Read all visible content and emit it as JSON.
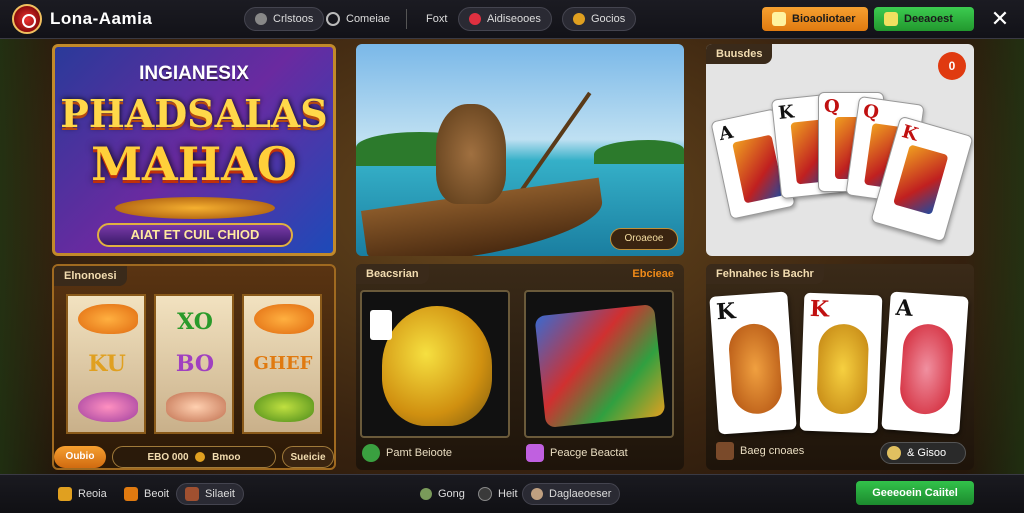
{
  "app": {
    "brand": "Lona-Aamia"
  },
  "topbar": {
    "nav": [
      {
        "label": "Crlstoos",
        "icon": "dice-icon"
      },
      {
        "label": "Comeiae",
        "icon": "clock-icon"
      },
      {
        "label": "Foxt",
        "icon": ""
      },
      {
        "label": "Aidiseooes",
        "icon": "chip-icon"
      },
      {
        "label": "Gocios",
        "icon": "coin-icon"
      }
    ],
    "btn_orange": "Bioaoliotaer",
    "btn_green": "Deeaoest",
    "close": "✕"
  },
  "panel1": {
    "line1": "INGIANESIX",
    "line2": "PHADSALAS",
    "line3": "MAHAO",
    "band": "AIAT ET CUIL CHIOD"
  },
  "panel2": {
    "button": "Oroaeoe"
  },
  "panel3": {
    "tag": "Buusdes",
    "badge": "0",
    "cards": [
      "A",
      "K",
      "Q",
      "Q",
      "K"
    ]
  },
  "panel4": {
    "tag": "Elnonoesi",
    "reels": [
      [
        "fish",
        "KU",
        "fish"
      ],
      [
        "XO",
        "BO",
        "chef"
      ],
      [
        "fish",
        "GHEF",
        "fish"
      ]
    ],
    "btn_left": "Oubio",
    "btn_mid": "EBO 000",
    "btn_mid_tail": "Bmoo",
    "btn_right": "Sueicie"
  },
  "panel5": {
    "tag": "Beacsrian",
    "tag_right": "Ebcieae",
    "tiles": [
      {
        "label": "Pamt Beioote"
      },
      {
        "label": "Peacge Beactat"
      }
    ]
  },
  "panel6": {
    "tag": "Fehnahec is Bachr",
    "cards": [
      "K",
      "K",
      "A"
    ],
    "label": "Baeg cnoaes",
    "pill": "& Gisoo"
  },
  "bottombar": {
    "left": [
      {
        "label": "Reoia"
      },
      {
        "label": "Beoit"
      },
      {
        "label": "Silaeit"
      }
    ],
    "center": [
      {
        "label": "Gong"
      },
      {
        "label": "Heit"
      },
      {
        "label": "Daglaeoeser"
      }
    ],
    "action": "Geeeoein Caiitel"
  },
  "colors": {
    "accent_orange": "#f08a18",
    "accent_green": "#2eb847",
    "gold": "#e0b040"
  }
}
